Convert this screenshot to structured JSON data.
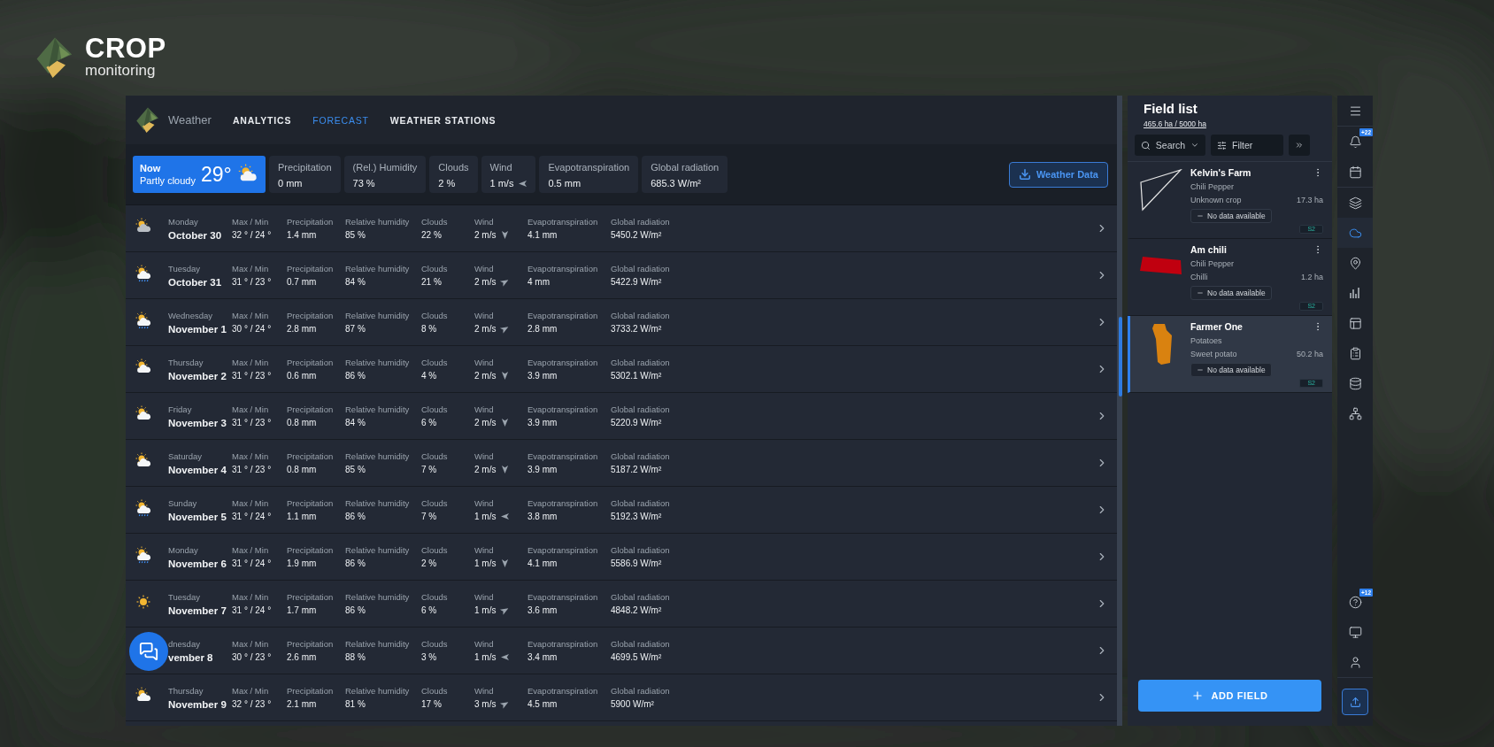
{
  "brand": {
    "name": "CROP",
    "sub": "monitoring"
  },
  "header": {
    "title": "Weather",
    "tabs": [
      {
        "label": "ANALYTICS",
        "selected": false
      },
      {
        "label": "FORECAST",
        "selected": true
      },
      {
        "label": "WEATHER STATIONS",
        "selected": false
      }
    ]
  },
  "now": {
    "label": "Now",
    "condition": "Partly cloudy",
    "temp": "29°",
    "kind": "partly-cloudy"
  },
  "current": [
    {
      "kind": "text",
      "label": "Precipitation",
      "value": "0 mm"
    },
    {
      "kind": "text",
      "label": "(Rel.) Humidity",
      "value": "73 %"
    },
    {
      "kind": "text",
      "label": "Clouds",
      "value": "2 %"
    },
    {
      "kind": "wind-left",
      "label": "Wind",
      "value": "1 m/s"
    },
    {
      "kind": "text",
      "label": "Evapotranspiration",
      "value": "0.5 mm"
    },
    {
      "kind": "text",
      "label": "Global radiation",
      "value": "685.3 W/m²"
    }
  ],
  "download_button": "Weather Data",
  "forecast": [
    {
      "kind": "cloudy",
      "day": "Monday",
      "date": "October 30",
      "cells": [
        {
          "kind": "text",
          "label": "Max / Min",
          "value": "32 ° / 24 °"
        },
        {
          "kind": "text",
          "label": "Precipitation",
          "value": "1.4 mm"
        },
        {
          "kind": "text",
          "label": "Relative humidity",
          "value": "85 %"
        },
        {
          "kind": "text",
          "label": "Clouds",
          "value": "22 %"
        },
        {
          "kind": "wind-down",
          "label": "Wind",
          "value": "2 m/s"
        },
        {
          "kind": "text",
          "label": "Evapotranspiration",
          "value": "4.1 mm"
        },
        {
          "kind": "text",
          "label": "Global radiation",
          "value": "5450.2 W/m²"
        }
      ]
    },
    {
      "kind": "rain",
      "day": "Tuesday",
      "date": "October 31",
      "cells": [
        {
          "kind": "text",
          "label": "Max / Min",
          "value": "31 ° / 23 °"
        },
        {
          "kind": "text",
          "label": "Precipitation",
          "value": "0.7 mm"
        },
        {
          "kind": "text",
          "label": "Relative humidity",
          "value": "84 %"
        },
        {
          "kind": "text",
          "label": "Clouds",
          "value": "21 %"
        },
        {
          "kind": "wind-northeast",
          "label": "Wind",
          "value": "2 m/s"
        },
        {
          "kind": "text",
          "label": "Evapotranspiration",
          "value": "4 mm"
        },
        {
          "kind": "text",
          "label": "Global radiation",
          "value": "5422.9 W/m²"
        }
      ]
    },
    {
      "kind": "rain",
      "day": "Wednesday",
      "date": "November 1",
      "cells": [
        {
          "kind": "text",
          "label": "Max / Min",
          "value": "30 ° / 24 °"
        },
        {
          "kind": "text",
          "label": "Precipitation",
          "value": "2.8 mm"
        },
        {
          "kind": "text",
          "label": "Relative humidity",
          "value": "87 %"
        },
        {
          "kind": "text",
          "label": "Clouds",
          "value": "8 %"
        },
        {
          "kind": "wind-northeast",
          "label": "Wind",
          "value": "2 m/s"
        },
        {
          "kind": "text",
          "label": "Evapotranspiration",
          "value": "2.8 mm"
        },
        {
          "kind": "text",
          "label": "Global radiation",
          "value": "3733.2 W/m²"
        }
      ]
    },
    {
      "kind": "partly-cloudy",
      "day": "Thursday",
      "date": "November 2",
      "cells": [
        {
          "kind": "text",
          "label": "Max / Min",
          "value": "31 ° / 23 °"
        },
        {
          "kind": "text",
          "label": "Precipitation",
          "value": "0.6 mm"
        },
        {
          "kind": "text",
          "label": "Relative humidity",
          "value": "86 %"
        },
        {
          "kind": "text",
          "label": "Clouds",
          "value": "4 %"
        },
        {
          "kind": "wind-down",
          "label": "Wind",
          "value": "2 m/s"
        },
        {
          "kind": "text",
          "label": "Evapotranspiration",
          "value": "3.9 mm"
        },
        {
          "kind": "text",
          "label": "Global radiation",
          "value": "5302.1 W/m²"
        }
      ]
    },
    {
      "kind": "partly-cloudy",
      "day": "Friday",
      "date": "November 3",
      "cells": [
        {
          "kind": "text",
          "label": "Max / Min",
          "value": "31 ° / 23 °"
        },
        {
          "kind": "text",
          "label": "Precipitation",
          "value": "0.8 mm"
        },
        {
          "kind": "text",
          "label": "Relative humidity",
          "value": "84 %"
        },
        {
          "kind": "text",
          "label": "Clouds",
          "value": "6 %"
        },
        {
          "kind": "wind-down",
          "label": "Wind",
          "value": "2 m/s"
        },
        {
          "kind": "text",
          "label": "Evapotranspiration",
          "value": "3.9 mm"
        },
        {
          "kind": "text",
          "label": "Global radiation",
          "value": "5220.9 W/m²"
        }
      ]
    },
    {
      "kind": "partly-cloudy",
      "day": "Saturday",
      "date": "November 4",
      "cells": [
        {
          "kind": "text",
          "label": "Max / Min",
          "value": "31 ° / 23 °"
        },
        {
          "kind": "text",
          "label": "Precipitation",
          "value": "0.8 mm"
        },
        {
          "kind": "text",
          "label": "Relative humidity",
          "value": "85 %"
        },
        {
          "kind": "text",
          "label": "Clouds",
          "value": "7 %"
        },
        {
          "kind": "wind-down",
          "label": "Wind",
          "value": "2 m/s"
        },
        {
          "kind": "text",
          "label": "Evapotranspiration",
          "value": "3.9 mm"
        },
        {
          "kind": "text",
          "label": "Global radiation",
          "value": "5187.2 W/m²"
        }
      ]
    },
    {
      "kind": "rain",
      "day": "Sunday",
      "date": "November 5",
      "cells": [
        {
          "kind": "text",
          "label": "Max / Min",
          "value": "31 ° / 24 °"
        },
        {
          "kind": "text",
          "label": "Precipitation",
          "value": "1.1 mm"
        },
        {
          "kind": "text",
          "label": "Relative humidity",
          "value": "86 %"
        },
        {
          "kind": "text",
          "label": "Clouds",
          "value": "7 %"
        },
        {
          "kind": "wind-left",
          "label": "Wind",
          "value": "1 m/s"
        },
        {
          "kind": "text",
          "label": "Evapotranspiration",
          "value": "3.8 mm"
        },
        {
          "kind": "text",
          "label": "Global radiation",
          "value": "5192.3 W/m²"
        }
      ]
    },
    {
      "kind": "rain",
      "day": "Monday",
      "date": "November 6",
      "cells": [
        {
          "kind": "text",
          "label": "Max / Min",
          "value": "31 ° / 24 °"
        },
        {
          "kind": "text",
          "label": "Precipitation",
          "value": "1.9 mm"
        },
        {
          "kind": "text",
          "label": "Relative humidity",
          "value": "86 %"
        },
        {
          "kind": "text",
          "label": "Clouds",
          "value": "2 %"
        },
        {
          "kind": "wind-down",
          "label": "Wind",
          "value": "1 m/s"
        },
        {
          "kind": "text",
          "label": "Evapotranspiration",
          "value": "4.1 mm"
        },
        {
          "kind": "text",
          "label": "Global radiation",
          "value": "5586.9 W/m²"
        }
      ]
    },
    {
      "kind": "sun",
      "day": "Tuesday",
      "date": "November 7",
      "cells": [
        {
          "kind": "text",
          "label": "Max / Min",
          "value": "31 ° / 24 °"
        },
        {
          "kind": "text",
          "label": "Precipitation",
          "value": "1.7 mm"
        },
        {
          "kind": "text",
          "label": "Relative humidity",
          "value": "86 %"
        },
        {
          "kind": "text",
          "label": "Clouds",
          "value": "6 %"
        },
        {
          "kind": "wind-northeast",
          "label": "Wind",
          "value": "1 m/s"
        },
        {
          "kind": "text",
          "label": "Evapotranspiration",
          "value": "3.6 mm"
        },
        {
          "kind": "text",
          "label": "Global radiation",
          "value": "4848.2 W/m²"
        }
      ]
    },
    {
      "kind": "hidden",
      "day": "dnesday",
      "date": "vember 8",
      "cells": [
        {
          "kind": "text",
          "label": "Max / Min",
          "value": "30 ° / 23 °"
        },
        {
          "kind": "text",
          "label": "Precipitation",
          "value": "2.6 mm"
        },
        {
          "kind": "text",
          "label": "Relative humidity",
          "value": "88 %"
        },
        {
          "kind": "text",
          "label": "Clouds",
          "value": "3 %"
        },
        {
          "kind": "wind-left",
          "label": "Wind",
          "value": "1 m/s"
        },
        {
          "kind": "text",
          "label": "Evapotranspiration",
          "value": "3.4 mm"
        },
        {
          "kind": "text",
          "label": "Global radiation",
          "value": "4699.5 W/m²"
        }
      ]
    },
    {
      "kind": "partly-cloudy",
      "day": "Thursday",
      "date": "November 9",
      "cells": [
        {
          "kind": "text",
          "label": "Max / Min",
          "value": "32 ° / 23 °"
        },
        {
          "kind": "text",
          "label": "Precipitation",
          "value": "2.1 mm"
        },
        {
          "kind": "text",
          "label": "Relative humidity",
          "value": "81 %"
        },
        {
          "kind": "text",
          "label": "Clouds",
          "value": "17 %"
        },
        {
          "kind": "wind-northeast",
          "label": "Wind",
          "value": "3 m/s"
        },
        {
          "kind": "text",
          "label": "Evapotranspiration",
          "value": "4.5 mm"
        },
        {
          "kind": "text",
          "label": "Global radiation",
          "value": "5900 W/m²"
        }
      ]
    }
  ],
  "field_list": {
    "title": "Field list",
    "area": "465.6 ha / 5000 ha",
    "search": "Search",
    "filter": "Filter",
    "fields": [
      {
        "kind": "outline",
        "name": "Kelvin's Farm",
        "crop": "Chili Pepper",
        "variety": "Unknown crop",
        "area": "17.3 ha",
        "status": "No data available",
        "tag": "S2",
        "color": "#e6e6e6",
        "selected": false
      },
      {
        "kind": "quad",
        "name": "Am chili",
        "crop": "Chili Pepper",
        "variety": "Chilli",
        "area": "1.2 ha",
        "status": "No data available",
        "tag": "S2",
        "color": "#c0000f",
        "selected": false
      },
      {
        "kind": "bottle",
        "name": "Farmer One",
        "crop": "Potatoes",
        "variety": "Sweet potato",
        "area": "50.2 ha",
        "status": "No data available",
        "tag": "S2",
        "color": "#d98210",
        "selected": true
      }
    ],
    "add_button": "ADD FIELD"
  },
  "rail": {
    "top": [
      {
        "kind": "menu",
        "selected": false
      },
      {
        "kind": "bell",
        "badge": "+22",
        "selected": false
      },
      {
        "kind": "calendar",
        "selected": false
      },
      {
        "kind": "layers",
        "selected": false
      },
      {
        "kind": "cloud",
        "selected": true
      },
      {
        "kind": "pin",
        "selected": false
      },
      {
        "kind": "chart",
        "selected": false
      },
      {
        "kind": "layout",
        "selected": false
      },
      {
        "kind": "clipboard",
        "selected": false
      },
      {
        "kind": "database",
        "selected": false
      },
      {
        "kind": "network",
        "selected": false
      }
    ],
    "bottom": [
      {
        "kind": "help",
        "badge": "+12",
        "selected": false
      },
      {
        "kind": "monitor",
        "selected": false
      },
      {
        "kind": "user",
        "selected": false
      }
    ]
  }
}
